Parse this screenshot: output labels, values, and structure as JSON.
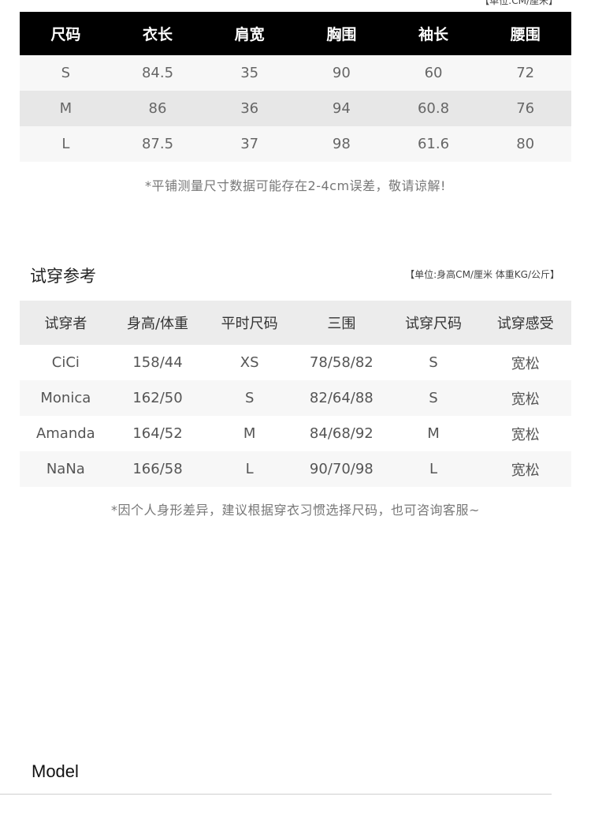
{
  "size_section": {
    "unit_note": "【单位:CM/厘米】",
    "headers": [
      "尺码",
      "衣长",
      "肩宽",
      "胸围",
      "袖长",
      "腰围"
    ],
    "rows": [
      [
        "S",
        "84.5",
        "35",
        "90",
        "60",
        "72"
      ],
      [
        "M",
        "86",
        "36",
        "94",
        "60.8",
        "76"
      ],
      [
        "L",
        "87.5",
        "37",
        "98",
        "61.6",
        "80"
      ]
    ],
    "note": "*平铺测量尺寸数据可能存在2-4cm误差，敬请谅解!"
  },
  "try_section": {
    "title": "试穿参考",
    "unit_note": "【单位:身高CM/厘米 体重KG/公斤】",
    "headers": [
      "试穿者",
      "身高/体重",
      "平时尺码",
      "三围",
      "试穿尺码",
      "试穿感受"
    ],
    "rows": [
      [
        "CiCi",
        "158/44",
        "XS",
        "78/58/82",
        "S",
        "宽松"
      ],
      [
        "Monica",
        "162/50",
        "S",
        "82/64/88",
        "S",
        "宽松"
      ],
      [
        "Amanda",
        "164/52",
        "M",
        "84/68/92",
        "M",
        "宽松"
      ],
      [
        "NaNa",
        "166/58",
        "L",
        "90/70/98",
        "L",
        "宽松"
      ]
    ],
    "note": "*因个人身形差异，建议根据穿衣习惯选择尺码，也可咨询客服~"
  },
  "model_section": {
    "title": "Model"
  }
}
